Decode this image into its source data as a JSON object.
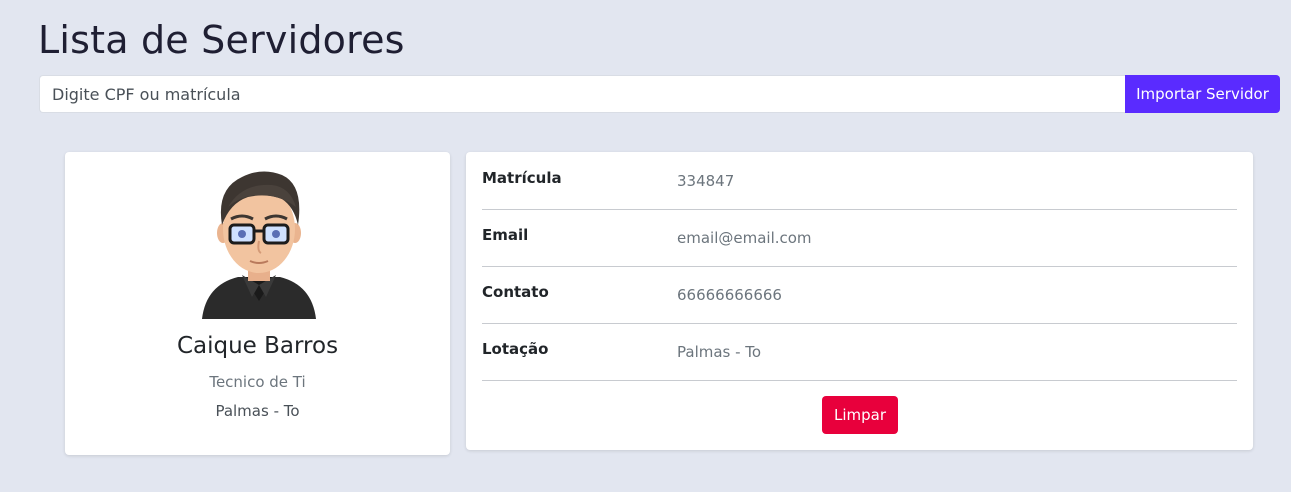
{
  "header": {
    "title": "Lista de Servidores"
  },
  "search": {
    "placeholder": "Digite CPF ou matrícula",
    "import_label": "Importar Servidor"
  },
  "profile": {
    "avatar_icon": "cartoon-man-avatar",
    "name": "Caique Barros",
    "role": "Tecnico de Ti",
    "location": "Palmas - To"
  },
  "details": {
    "rows": [
      {
        "label": "Matrícula",
        "value": "334847"
      },
      {
        "label": "Email",
        "value": "email@email.com"
      },
      {
        "label": "Contato",
        "value": "66666666666"
      },
      {
        "label": "Lotação",
        "value": "Palmas - To"
      }
    ],
    "clear_label": "Limpar"
  },
  "colors": {
    "background": "#e2e6f0",
    "primary_button": "#5a2bff",
    "danger_button": "#e8003c"
  }
}
